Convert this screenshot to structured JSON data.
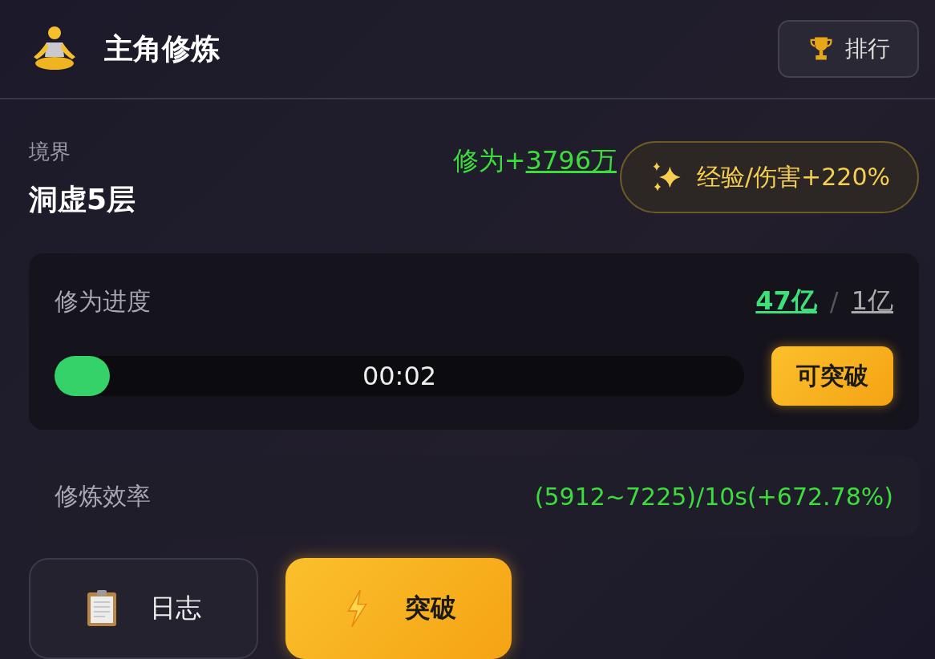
{
  "header": {
    "title": "主角修炼",
    "ranking_button": "排行"
  },
  "realm": {
    "label": "境界",
    "value": "洞虚5层"
  },
  "gain": {
    "prefix": "修为+",
    "amount": "3796万"
  },
  "bonus": "经验/伤害+220%",
  "progress": {
    "title": "修为进度",
    "current": "47亿",
    "separator": "/",
    "required": "1亿",
    "level": 0.08,
    "timer": "00:02",
    "breakthrough_ready": "可突破"
  },
  "efficiency": {
    "label": "修炼效率",
    "value": "(5912~7225)/10s(+672.78%)"
  },
  "actions": [
    {
      "kind": "log",
      "label": "日志"
    },
    {
      "kind": "breakthrough",
      "label": "突破"
    }
  ]
}
